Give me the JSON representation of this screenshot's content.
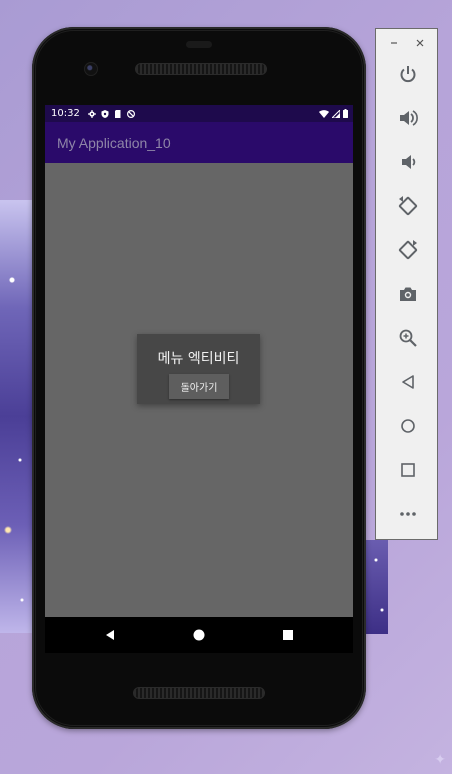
{
  "status_bar": {
    "time": "10:32",
    "icons_left": [
      "settings-icon",
      "shield-icon",
      "sim-card-icon",
      "no-disturb-icon"
    ],
    "icons_right": [
      "wifi-icon",
      "signal-icon",
      "battery-icon"
    ]
  },
  "app_bar": {
    "title": "My Application_10"
  },
  "dialog": {
    "heading": "메뉴 엑티비티",
    "button_label": "돌아가기"
  },
  "nav_bar": {
    "buttons": [
      "back-icon",
      "home-icon",
      "recents-icon"
    ]
  },
  "emulator_panel": {
    "window_controls": [
      "minimize-icon",
      "close-icon"
    ],
    "tools": [
      "power-icon",
      "volume-up-icon",
      "volume-down-icon",
      "rotate-left-icon",
      "rotate-right-icon",
      "camera-icon",
      "zoom-icon",
      "back-icon",
      "home-icon",
      "overview-icon",
      "more-icon"
    ]
  },
  "colors": {
    "status_bar": "#1e0a4c",
    "app_bar": "#2a0a6a",
    "screen_background": "#666666",
    "dialog_background": "#474747"
  }
}
